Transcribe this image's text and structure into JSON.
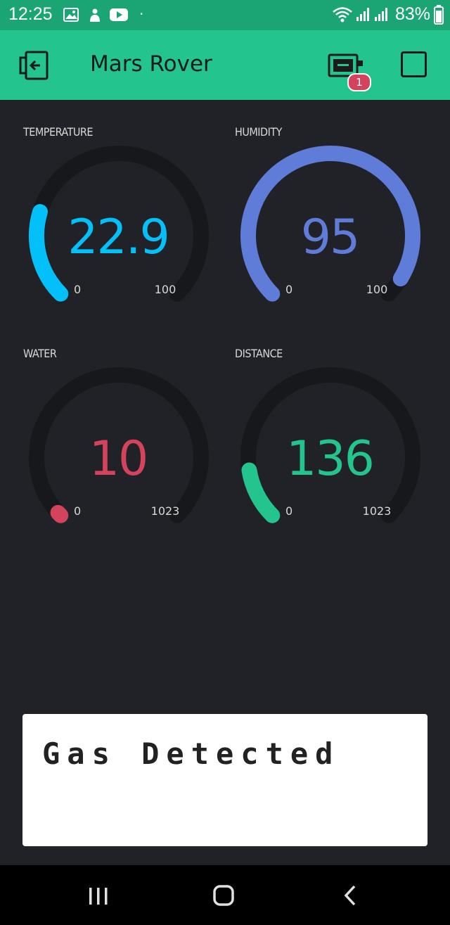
{
  "status_bar": {
    "time": "12:25",
    "battery": "83%"
  },
  "app_bar": {
    "title": "Mars Rover",
    "device_badge": "1"
  },
  "gauges": [
    {
      "label": "TEMPERATURE",
      "value": "22.9",
      "min": "0",
      "max": "100",
      "fraction": 0.229,
      "color": "#04c0f8"
    },
    {
      "label": "HUMIDITY",
      "value": "95",
      "min": "0",
      "max": "100",
      "fraction": 0.95,
      "color": "#5f7cd8"
    },
    {
      "label": "WATER",
      "value": "10",
      "min": "0",
      "max": "1023",
      "fraction": 0.0098,
      "color": "#d3435c"
    },
    {
      "label": "DISTANCE",
      "value": "136",
      "min": "0",
      "max": "1023",
      "fraction": 0.133,
      "color": "#23c48e"
    }
  ],
  "lcd": {
    "line1": "Gas Detected",
    "line2": ""
  },
  "colors": {
    "status_bar": "#1ba574",
    "app_bar": "#23c48e",
    "background": "#212227",
    "track": "#17181c"
  }
}
